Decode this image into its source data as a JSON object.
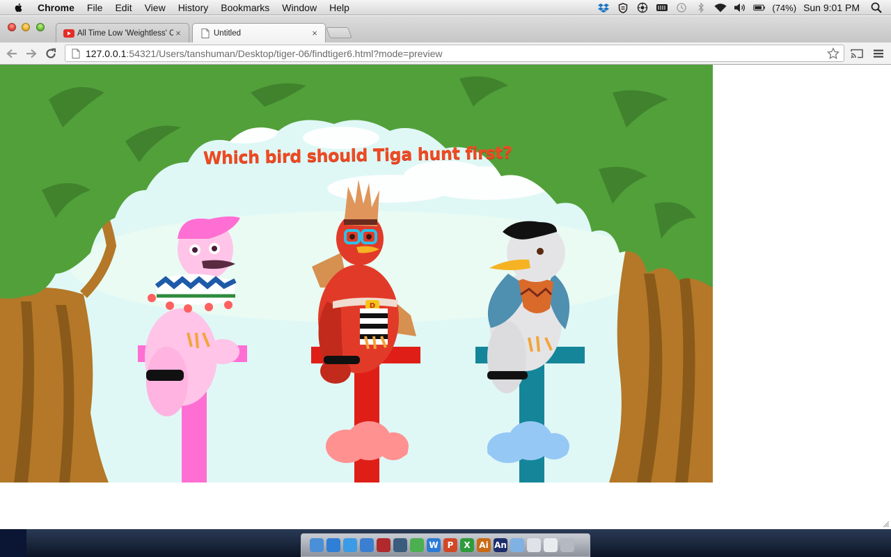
{
  "menubar": {
    "app_name": "Chrome",
    "menus": [
      "File",
      "Edit",
      "View",
      "History",
      "Bookmarks",
      "Window",
      "Help"
    ],
    "battery": "(74%)",
    "clock": "Sun 9:01 PM",
    "status_icons": [
      "dropbox-icon",
      "shield-icon",
      "gear-icon",
      "battery-meter-icon",
      "time-machine-icon",
      "bluetooth-icon",
      "wifi-icon",
      "volume-icon",
      "battery-icon",
      "spotlight-icon"
    ]
  },
  "tabs": [
    {
      "title": "All Time Low 'Weightless' C",
      "favicon": "youtube-icon",
      "active": false
    },
    {
      "title": "Untitled",
      "favicon": "page-icon",
      "active": true
    }
  ],
  "tab_close_glyph": "×",
  "address_bar": {
    "host": "127.0.0.1",
    "rest": ":54321/Users/tanshuman/Desktop/tiger-06/findtiger6.html?mode=preview"
  },
  "game": {
    "question": "Which bird should Tiga hunt first?",
    "birds": [
      {
        "name": "pink-bird",
        "perch_color": "#ff6fd3"
      },
      {
        "name": "red-bird",
        "perch_color": "#df1f17",
        "badge": "D"
      },
      {
        "name": "white-bird",
        "perch_color": "#15869a"
      }
    ],
    "colors": {
      "sky": "#dff8f6",
      "leaves": "#52a03a",
      "trunk": "#b47828",
      "question": "#ee4a22"
    }
  },
  "dock": {
    "apps": [
      {
        "name": "finder-icon",
        "label": "",
        "color": "#4a8fd8"
      },
      {
        "name": "app-store-icon",
        "label": "",
        "color": "#2f7fd6"
      },
      {
        "name": "safari-icon",
        "label": "",
        "color": "#3c9be6"
      },
      {
        "name": "itunes-icon",
        "label": "",
        "color": "#3b7fd0"
      },
      {
        "name": "photo-booth-icon",
        "label": "",
        "color": "#b0292c"
      },
      {
        "name": "time-machine-icon",
        "label": "",
        "color": "#3a5d7e"
      },
      {
        "name": "chrome-icon",
        "label": "",
        "color": "#4caf50"
      },
      {
        "name": "word-icon",
        "label": "W",
        "color": "#2c7bd6"
      },
      {
        "name": "powerpoint-icon",
        "label": "P",
        "color": "#d24726"
      },
      {
        "name": "excel-icon",
        "label": "X",
        "color": "#2f9b3c"
      },
      {
        "name": "illustrator-icon",
        "label": "Ai",
        "color": "#c96a14"
      },
      {
        "name": "animate-icon",
        "label": "An",
        "color": "#1d2d6b"
      },
      {
        "name": "applications-folder-icon",
        "label": "",
        "color": "#7fb1e3"
      },
      {
        "name": "documents-folder-icon",
        "label": "",
        "color": "#dfe3e8"
      },
      {
        "name": "screenshot-icon",
        "label": "",
        "color": "#e9ecef"
      },
      {
        "name": "trash-icon",
        "label": "",
        "color": "#b5bac1"
      }
    ]
  }
}
